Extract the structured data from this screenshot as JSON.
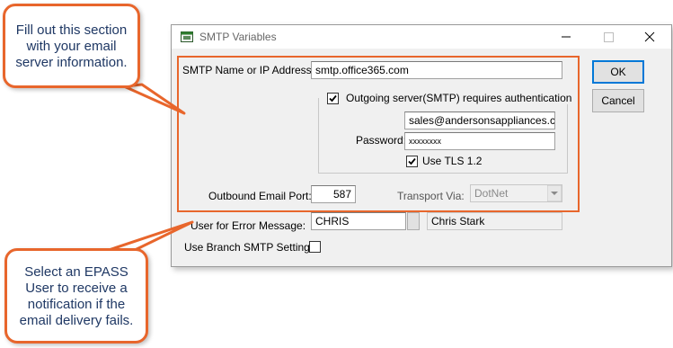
{
  "window": {
    "title": "SMTP Variables",
    "minimize_glyph": "—",
    "maximize_glyph": "☐",
    "close_glyph": "✕"
  },
  "form": {
    "smtp_label": "SMTP Name or IP Address:",
    "smtp_value": "smtp.office365.com",
    "auth_label": "Outgoing server(SMTP) requires authentication",
    "auth_checked": true,
    "username_value": "sales@andersonsappliances.com",
    "password_label": "Password:",
    "password_value": "xxxxxxxx",
    "tls_label": "Use TLS 1.2",
    "tls_checked": true,
    "port_label": "Outbound Email Port:",
    "port_value": "587",
    "transport_label": "Transport Via:",
    "transport_value": "DotNet",
    "error_user_label": "User for Error Message:",
    "error_user_value": "CHRIS",
    "error_user_name": "Chris Stark",
    "branch_label": "Use Branch SMTP Settings",
    "branch_checked": false
  },
  "buttons": {
    "ok_label": "OK",
    "cancel_label": "Cancel"
  },
  "callouts": {
    "top": [
      "Fill out this section",
      "with your email",
      "server information."
    ],
    "bottom": [
      "Select an EPASS",
      "User to receive a",
      "notification if the",
      "email delivery fails."
    ]
  },
  "colors": {
    "accent": "#e8662c",
    "callout_text": "#1f3864",
    "default_button": "#0078d7"
  }
}
